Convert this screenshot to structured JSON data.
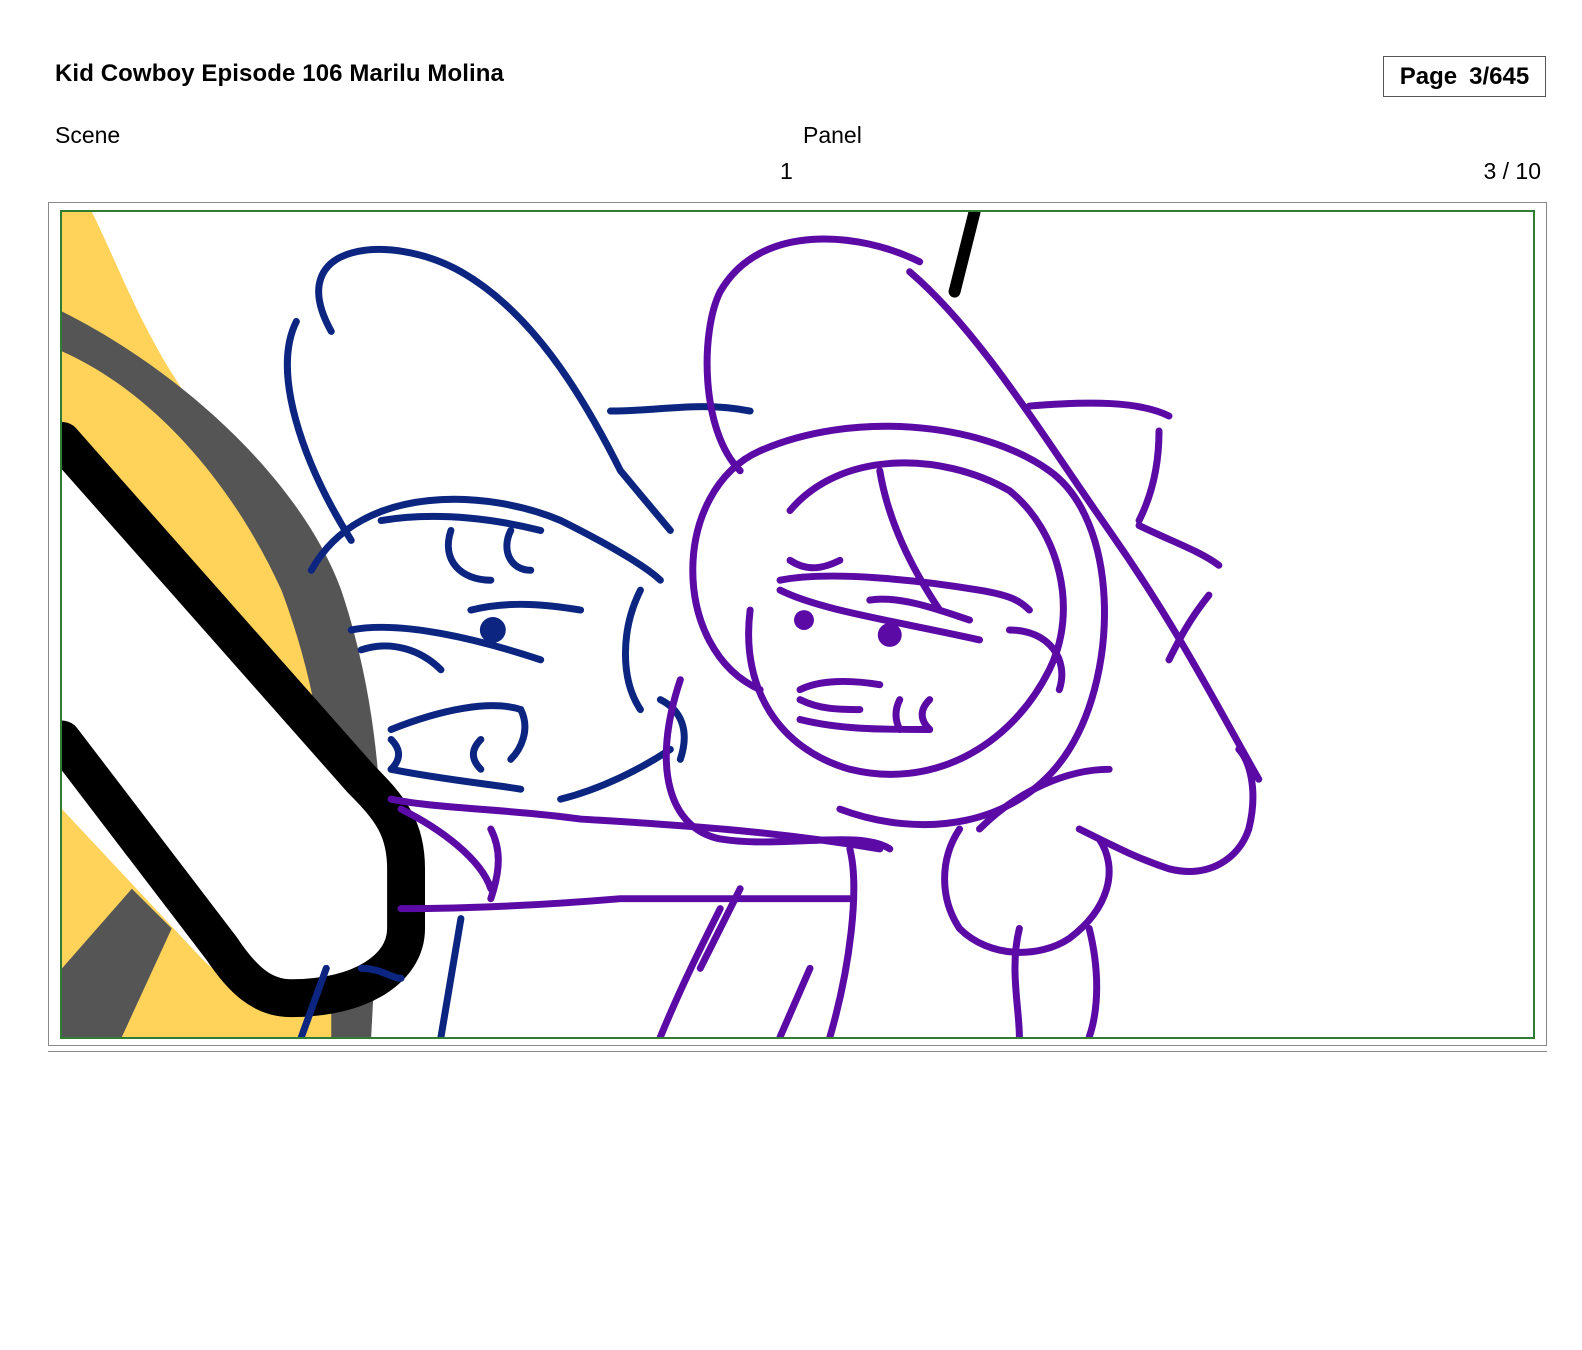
{
  "header": {
    "title": "Kid Cowboy Episode 106 Marilu Molina",
    "page_label": "Page",
    "page_value": "3/645"
  },
  "meta": {
    "scene_label": "Scene",
    "panel_label": "Panel",
    "scene_number": "1",
    "panel_number": "3 / 10"
  },
  "panel": {
    "image_icon": "storyboard-sketch",
    "colors": {
      "frame": "#2e7d32",
      "left_character": "#0b2580",
      "right_character": "#5b0aa6",
      "foreground_yellow": "#ffd35a",
      "foreground_gray": "#555555"
    }
  }
}
